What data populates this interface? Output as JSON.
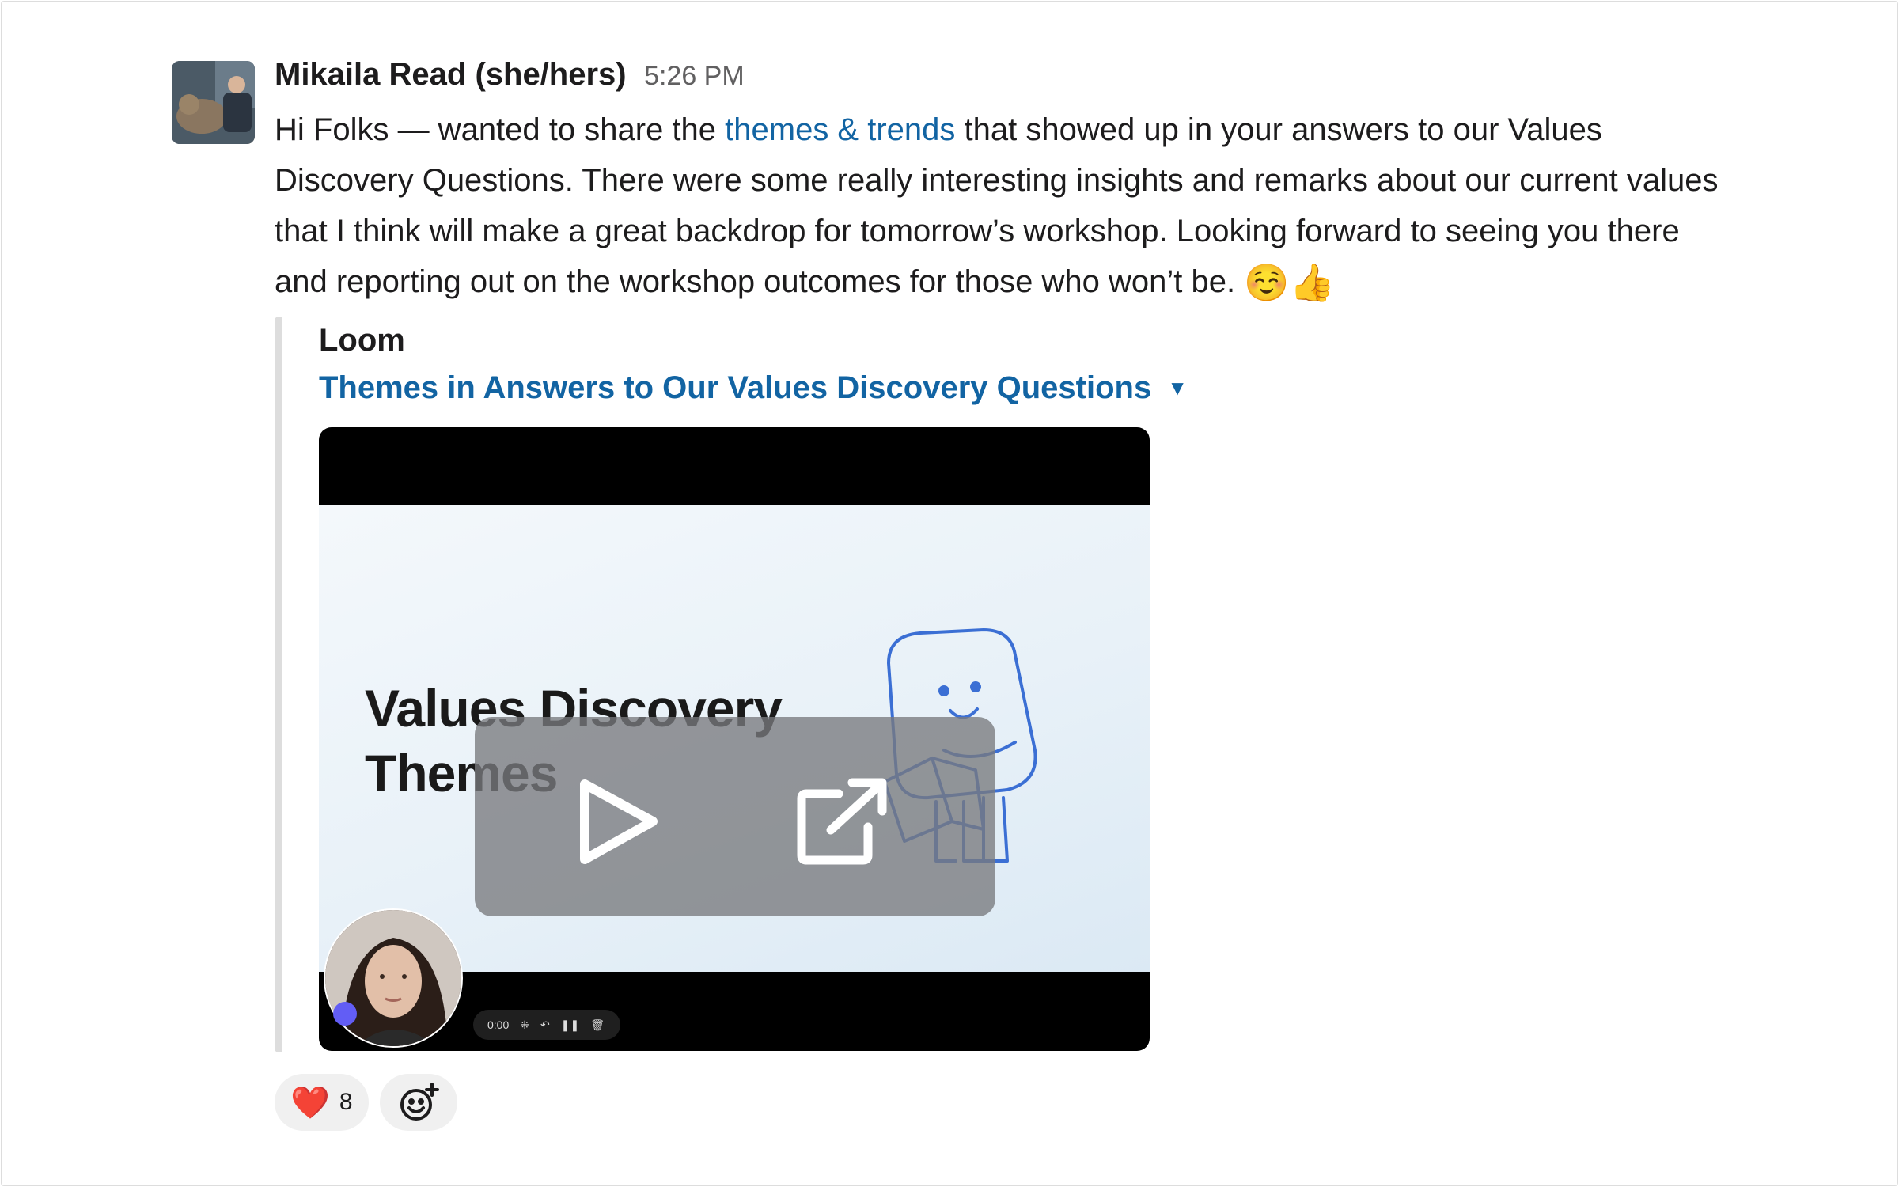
{
  "message": {
    "sender": "Mikaila Read (she/hers)",
    "timestamp": "5:26 PM",
    "text_before_link": "Hi Folks — wanted to share the ",
    "link_text": "themes & trends",
    "text_after_link": " that showed up in your answers to our Values Discovery Questions. There were some really interesting insights and remarks about our current values that I think will make a great backdrop for tomorrow’s workshop. Looking forward to seeing you there and reporting out on the workshop outcomes for those who won’t be. ",
    "emojis": "☺️👍"
  },
  "attachment": {
    "source": "Loom",
    "title": "Themes in Answers to Our Values Discovery Questions",
    "caret": "▼",
    "video": {
      "slide_title_line1": "Values Discovery",
      "slide_title_line2": "Themes",
      "recorder_time": "0:00",
      "recorder_controls": [
        "⁜",
        "↶",
        "❚❚",
        "🗑"
      ]
    }
  },
  "reactions": [
    {
      "emoji": "❤️",
      "count": "8"
    }
  ],
  "icons": {
    "play": "play-icon",
    "external": "external-link-icon",
    "add_reaction": "add-reaction-icon"
  }
}
